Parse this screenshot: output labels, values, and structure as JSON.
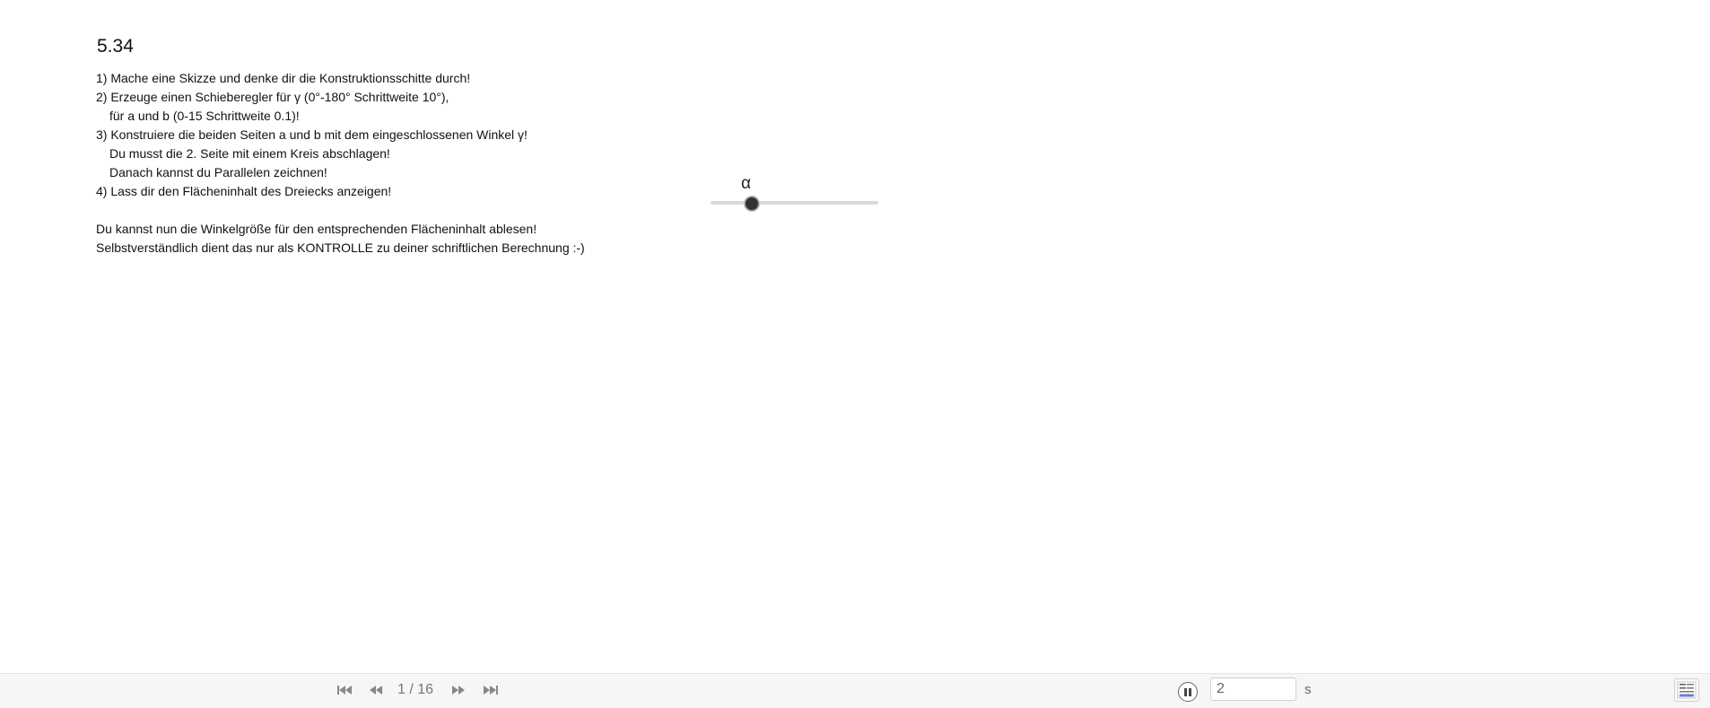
{
  "sheet": {
    "title": "5.34",
    "instructions": [
      {
        "text": "1) Mache eine Skizze und denke dir die Konstruktionsschitte durch!",
        "indent": false
      },
      {
        "text": "2) Erzeuge einen Schieberegler für γ (0°-180° Schrittweite 10°),",
        "indent": false
      },
      {
        "text": "für a und b (0-15 Schrittweite 0.1)!",
        "indent": true
      },
      {
        "text": "3) Konstruiere die beiden Seiten a und b mit dem eingeschlossenen Winkel γ!",
        "indent": false
      },
      {
        "text": "Du musst die 2. Seite mit einem Kreis abschlagen!",
        "indent": true
      },
      {
        "text": "Danach kannst du Parallelen zeichnen!",
        "indent": true
      },
      {
        "text": "4) Lass dir den Flächeninhalt des Dreiecks anzeigen!",
        "indent": false
      },
      {
        "text": "",
        "indent": false
      },
      {
        "text": "Du kannst nun die Winkelgröße für den entsprechenden Flächeninhalt ablesen!",
        "indent": false
      },
      {
        "text": "Selbstverständlich dient das nur als KONTROLLE zu deiner schriftlichen Berechnung :-)",
        "indent": false
      }
    ]
  },
  "slider": {
    "label": "α",
    "value_fraction": 0.24
  },
  "playback": {
    "page_indicator": "1 / 16",
    "speed_value": "2",
    "speed_unit": "s"
  },
  "icons": {
    "first": "skip-to-first-icon",
    "prev": "rewind-icon",
    "next": "fast-forward-icon",
    "last": "skip-to-last-icon",
    "pause": "pause-icon",
    "algebra": "algebra-view-icon"
  },
  "colors": {
    "knob": "#333333",
    "track": "#d9d9d9",
    "bar": "#f6f6f6",
    "icon": "#888888"
  }
}
